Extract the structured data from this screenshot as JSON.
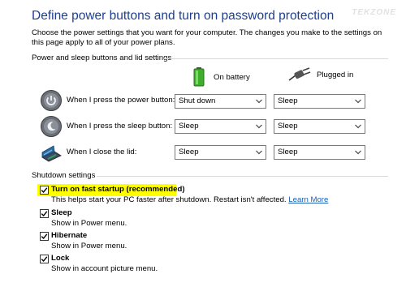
{
  "page": {
    "title": "Define power buttons and turn on password protection",
    "watermark": "TEKZONE",
    "intro": "Choose the power settings that you want for your computer. The changes you make to the settings on this page apply to all of your power plans."
  },
  "power_section": {
    "heading": "Power and sleep buttons and lid settings",
    "col_battery": "On battery",
    "col_plugged": "Plugged in",
    "rows": [
      {
        "label": "When I press the power button:",
        "battery": "Shut down",
        "plugged": "Sleep",
        "icon": "power-button-icon"
      },
      {
        "label": "When I press the sleep button:",
        "battery": "Sleep",
        "plugged": "Sleep",
        "icon": "sleep-button-icon"
      },
      {
        "label": "When I close the lid:",
        "battery": "Sleep",
        "plugged": "Sleep",
        "icon": "laptop-lid-icon"
      }
    ]
  },
  "shutdown_section": {
    "heading": "Shutdown settings",
    "fast_startup": {
      "title": "Turn on fast startup (recommended)",
      "desc": "This helps start your PC faster after shutdown. Restart isn't affected.",
      "link": "Learn More",
      "checked": true
    },
    "sleep": {
      "title": "Sleep",
      "desc": "Show in Power menu.",
      "checked": true
    },
    "hibernate": {
      "title": "Hibernate",
      "desc": "Show in Power menu.",
      "checked": true
    },
    "lock": {
      "title": "Lock",
      "desc": "Show in account picture menu.",
      "checked": true
    }
  },
  "colors": {
    "title": "#1e3f8f",
    "link": "#1a5fb4",
    "highlight": "#ffff00"
  }
}
